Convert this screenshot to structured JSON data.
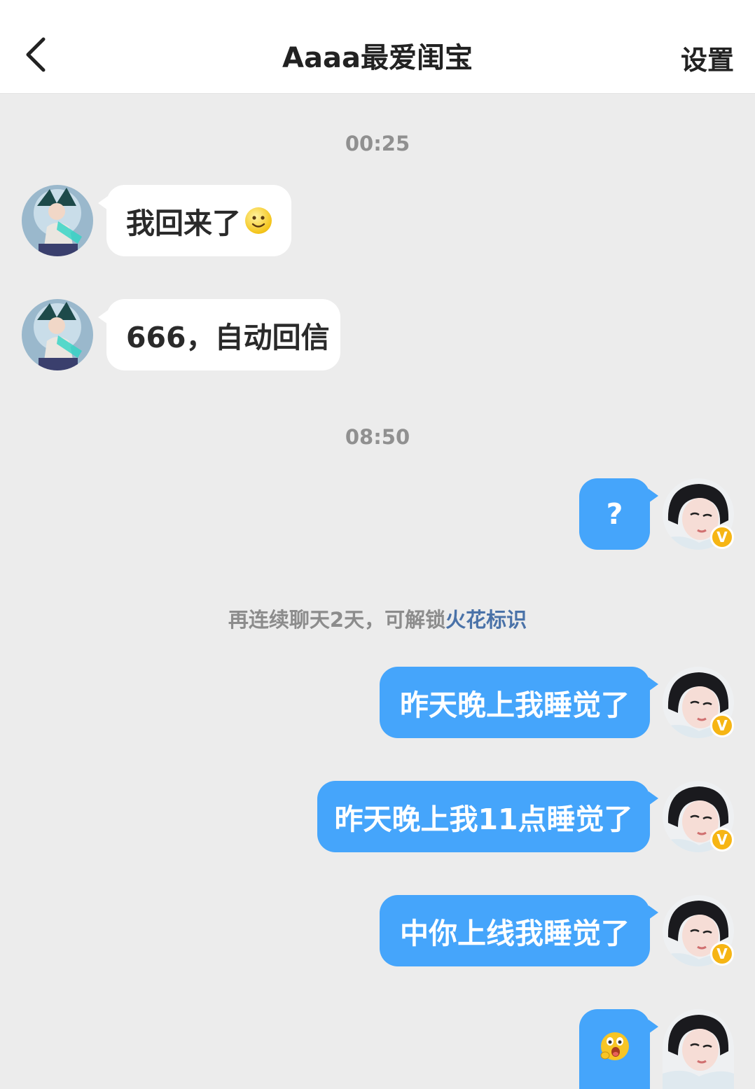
{
  "header": {
    "back_icon": "chevron-left-icon",
    "title": "Aaaa最爱闺宝",
    "settings_label": "设置"
  },
  "messages": {
    "time_1": "00:25",
    "in_1": "我回来了",
    "in_1_emoji": "smile-emoji-icon",
    "in_2": "666，自动回信",
    "time_2": "08:50",
    "out_1": "?",
    "system_note_prefix": "再连续聊天2天，可解锁",
    "system_note_link": "火花标识",
    "out_2": "昨天晚上我睡觉了",
    "out_3": "昨天晚上我11点睡觉了",
    "out_4": "中你上线我睡觉了",
    "out_5_emoji": "surprised-emoji-icon"
  },
  "badge_label": "V",
  "colors": {
    "outgoing_bubble": "#45a5fb",
    "incoming_bubble": "#ffffff",
    "background": "#ececec",
    "link": "#4a72a8",
    "badge": "#f6b514"
  }
}
